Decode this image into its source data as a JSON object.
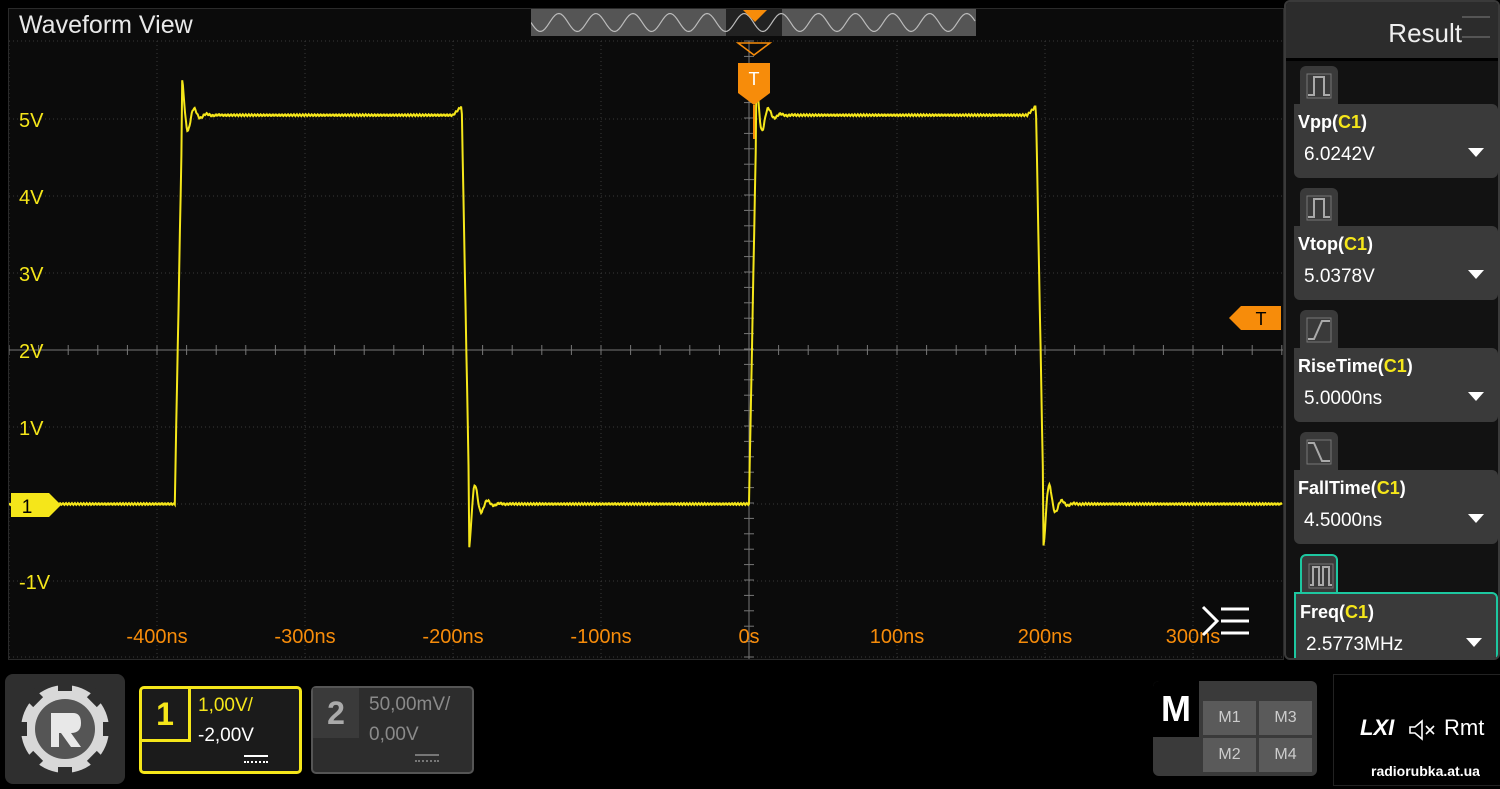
{
  "waveform_view": {
    "title": "Waveform View",
    "y_labels": [
      "5V",
      "4V",
      "3V",
      "2V",
      "1V",
      "-1V"
    ],
    "x_labels": [
      "-400ns",
      "-300ns",
      "-200ns",
      "-100ns",
      "0s",
      "100ns",
      "200ns",
      "300ns"
    ],
    "trigger_marker": "T",
    "trigger_level_marker": "T",
    "channel_marker": "1",
    "trace_color": "#f5e61a",
    "trigger_color": "#f78c0a"
  },
  "result_panel": {
    "title": "Result",
    "measurements": [
      {
        "name": "Vpp",
        "source": "C1",
        "value": "6.0242V",
        "icon": "pulse-icon"
      },
      {
        "name": "Vtop",
        "source": "C1",
        "value": "5.0378V",
        "icon": "pulse-icon"
      },
      {
        "name": "RiseTime",
        "source": "C1",
        "value": "5.0000ns",
        "icon": "rise-edge-icon"
      },
      {
        "name": "FallTime",
        "source": "C1",
        "value": "4.5000ns",
        "icon": "fall-edge-icon"
      },
      {
        "name": "Freq",
        "source": "C1",
        "value": "2.5773MHz",
        "icon": "frequency-icon"
      }
    ]
  },
  "channels": [
    {
      "number": "1",
      "scale": "1,00V/",
      "offset": "-2,00V",
      "active": true
    },
    {
      "number": "2",
      "scale": "50,00mV/",
      "offset": "0,00V",
      "active": false
    }
  ],
  "math": {
    "label": "M",
    "buttons": [
      "M1",
      "M3",
      "M2",
      "M4"
    ]
  },
  "status": {
    "lxi": "LXI",
    "remote": "Rmt"
  },
  "watermark": "radiorubka.at.ua"
}
